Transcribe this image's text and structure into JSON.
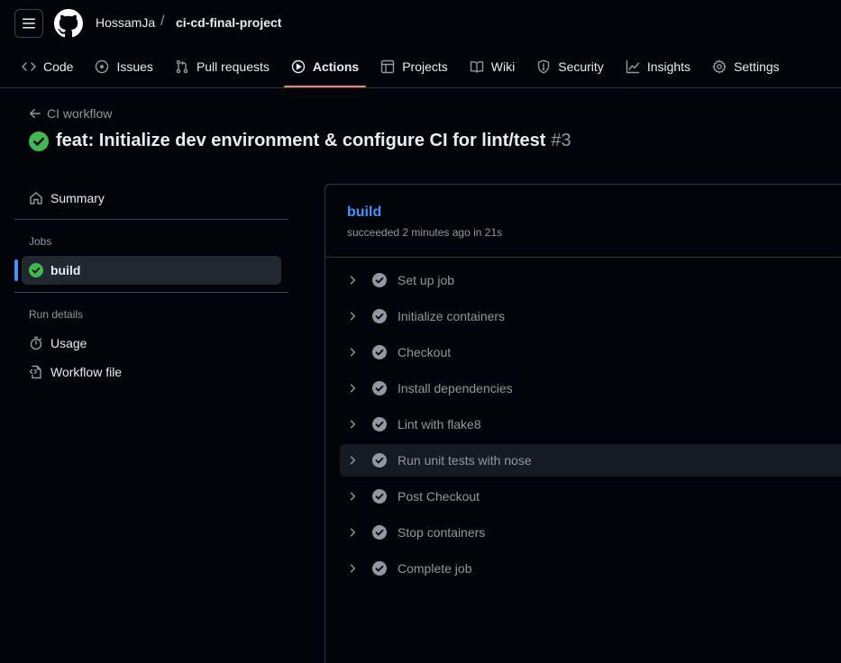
{
  "header": {
    "owner": "HossamJa",
    "separator": "/",
    "repo": "ci-cd-final-project"
  },
  "tabs": [
    {
      "label": "Code",
      "icon": "code-icon"
    },
    {
      "label": "Issues",
      "icon": "issue-opened-icon"
    },
    {
      "label": "Pull requests",
      "icon": "git-pull-request-icon"
    },
    {
      "label": "Actions",
      "icon": "play-icon",
      "active": true
    },
    {
      "label": "Projects",
      "icon": "table-icon"
    },
    {
      "label": "Wiki",
      "icon": "book-icon"
    },
    {
      "label": "Security",
      "icon": "shield-icon"
    },
    {
      "label": "Insights",
      "icon": "graph-icon"
    },
    {
      "label": "Settings",
      "icon": "gear-icon"
    }
  ],
  "run": {
    "back_label": "CI workflow",
    "title": "feat: Initialize dev environment & configure CI for lint/test",
    "number": "#3",
    "status": "success"
  },
  "sidebar": {
    "summary_label": "Summary",
    "jobs_heading": "Jobs",
    "jobs": [
      {
        "label": "build",
        "status": "success",
        "selected": true
      }
    ],
    "run_details_heading": "Run details",
    "details": [
      {
        "label": "Usage",
        "icon": "stopwatch-icon"
      },
      {
        "label": "Workflow file",
        "icon": "file-code-icon"
      }
    ]
  },
  "job": {
    "name": "build",
    "meta": "succeeded 2 minutes ago in 21s",
    "steps": [
      {
        "label": "Set up job"
      },
      {
        "label": "Initialize containers"
      },
      {
        "label": "Checkout"
      },
      {
        "label": "Install dependencies"
      },
      {
        "label": "Lint with flake8"
      },
      {
        "label": "Run unit tests with nose",
        "hovered": true
      },
      {
        "label": "Post Checkout"
      },
      {
        "label": "Stop containers"
      },
      {
        "label": "Complete job"
      }
    ]
  },
  "colors": {
    "background": "#010409",
    "text": "#e6edf3",
    "muted": "#9198a1",
    "accent_blue": "#4493f8",
    "success_green": "#3fb950",
    "tab_underline": "#f78166",
    "border": "#30363d"
  }
}
